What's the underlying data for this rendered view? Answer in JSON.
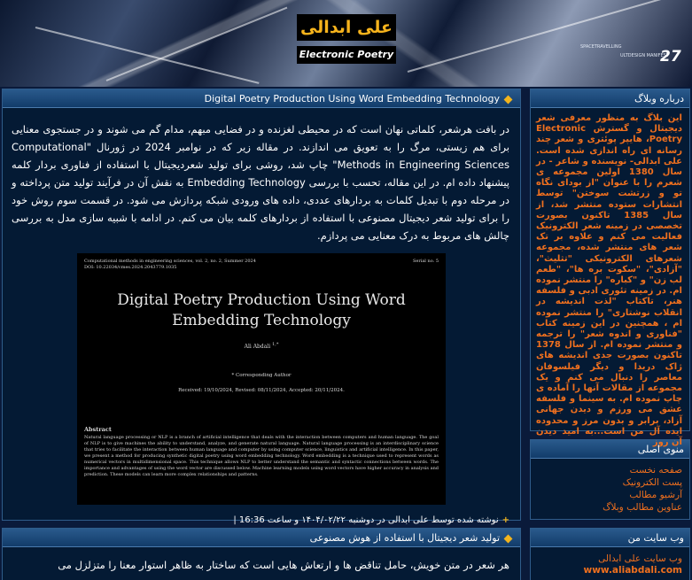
{
  "header": {
    "title": "علی ابدالی",
    "subtitle": "Electronic Poetry",
    "tag1": "SPACETRAVELLING",
    "tag2": "ULTDESIGN MANIFEST",
    "number": "27"
  },
  "posts": [
    {
      "title": "Digital Poetry Production Using Word Embedding Technology",
      "body": "در بافت هرشعر، کلماتی نهان است که در محیطی لغزنده و در فضایی مبهم، مدام گم می شوند و در جستجوی معنایی برای هم زیستی، مرگ را به تعویق می اندازند. در مقاله زیر که در نوامبر 2024 در ژورنال \"Computational Methods in Engineering Sciences\" چاپ شد، روشی برای تولید شعردیجیتال با استفاده از فناوری بردار کلمه پیشنهاد داده ام. در این مقاله، تحسب با بررسی Embedding Technology به نقش آن در فرآیند تولید متن پرداخته و در مرحله دوم با تبدیل کلمات به بردارهای عددی، داده های ورودی شبکه پردازش می شود. در قسمت سوم روش خود را برای تولید شعر دیجیتال مصنوعی با استفاده از بردارهای کلمه بیان می کنم. در ادامه با شبیه سازی مدل به بررسی چالش های مربوط به درک معنایی می پردازم.",
      "image": {
        "journal": "Computational methods in engineering sciences, vol. 2, no. 2, Summer 2024",
        "doi": "DOI: 10.22034/cmes.2024.2043779.1035",
        "serial": "Serial no. 5",
        "title": "Digital Poetry Production Using Word Embedding Technology",
        "author": "Ali Abdali",
        "author_mark": "1,*",
        "corresponding": "* Corresponding Author",
        "received": "Received: 19/10/2024, Revised: 08/11/2024, Accepted: 20/11/2024.",
        "abstract_heading": "Abstract",
        "abstract": "Natural language processing or NLP is a branch of artificial intelligence that deals with the interaction between computers and human language. The goal of NLP is to give machines the ability to understand, analyze, and generate natural language. Natural language processing is an interdisciplinary science that tries to facilitate the interaction between human language and computer by using computer science, linguistics and artificial intelligence. In this paper, we present a method for producing synthetic digital poetry using word embedding technology. Word embedding is a technique used to represent words as numerical vectors in multidimensional space. This technique allows NLP to better understand the semantic and syntactic connections between words. The importance and advantages of using the word vector are discussed below. Machine learning models using word vectors have higher accuracy in analysis and prediction. These models can learn more complex relationships and patterns."
      },
      "footer": "نوشته شده توسط علی ابدالی در دوشنبه ۱۴۰۴/۰۲/۲۲ و ساعت 16:36 |"
    },
    {
      "title": "تولید شعر دیجیتال با استفاده از هوش مصنوعی",
      "body": "هر شعر در متن خویش، حامل تناقض ها و ارتعاش هایی است که ساختار به ظاهر استوار معنا را متزلزل می"
    }
  ],
  "sidebar": {
    "about": {
      "title": "درباره وبلاگ",
      "text": "این بلاگ به منظور معرفی شعر دیجیتال و گسترش Electronic Poetry، هایپر پوئتری و شعر چند رسانه ای راه اندازی شده است. علی ابدالی- نویسنده و شاعر - در سال 1380 اولین مجموعه ی شعرم را با عنوان \"از بودای نگاه تو و زرتشت سوختن\" توسط انتشارات ستوده منتشر شد، از سال 1385 تاکنون بصورت تخصصی در زمینه شعر الکترونیک فعالیت می کنم و علاوه بر تک شعر های منتشر شده، مجموعه شعرهای الکترونیکی \"تثلیث\"، \"آزادی\"، \"سکوت بره ها\"، \"طعم لب زن\" و \"کباره\" را منتشر نموده ام. در زمینه تئوری ادبی و فلسفه هنر، تاکتاب \"لذت اندیشه در انقلاب نوشتاری\" را منتشر نموده ام ، همچنین در این زمینه کتاب \"فناوری و اندوه شعر\" را ترجمه و منتشر نموده ام. از سال 1378 تاکنون بصورت جدی اندیشه های ژاک دریدا و دیگر فیلسوفان معاصر را دنبال می کنم و یک مجموعه از مقالات آنها را آماده ی چاپ نموده ام. به سینما و فلسفه عشق می ورزم و دیدن جهانی آزاد، برابر و بدون مرز و محدوده ایده آل من است...به امید دیدن آن روز"
    },
    "menu": {
      "title": "منوی اصلی",
      "items": [
        "صفحه نخست",
        "پست الکترونیک",
        "آرشیو مطالب",
        "عناوین مطالب وبلاگ"
      ]
    },
    "website": {
      "title": "وب سایت من",
      "label": "وب سایت علی ابدالی",
      "url": "www.aliabdali.com"
    }
  },
  "colors": {
    "page_bg": "#0a1a3a",
    "box_bg": "#041a34",
    "accent_orange": "#f0701e",
    "accent_yellow": "#f2b41d",
    "header_title_gold": "#f6b31c"
  }
}
